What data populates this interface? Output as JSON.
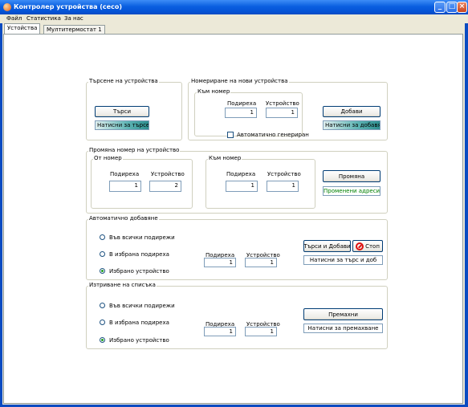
{
  "window": {
    "title": "Контролер устройства (сесо)"
  },
  "menu": [
    "Файл",
    "Статистика",
    "За нас"
  ],
  "tabs": [
    "Устойства",
    "Мултитермостат 1"
  ],
  "search": {
    "legend": "Търсене на устройства",
    "button": "Търси",
    "status": "Натисни за търсене"
  },
  "numbering": {
    "legend": "Номериране на нови устройства",
    "sub_legend": "Към номер",
    "section_label": "Подиреха",
    "device_label": "Устройство",
    "section_value": "1",
    "device_value": "1",
    "auto_label": "Автоматично генериран",
    "add_button": "Добави",
    "status": "Натисни за добавяне"
  },
  "change": {
    "legend": "Промяна номер на устройство",
    "from_legend": "От номер",
    "to_legend": "Към номер",
    "section_label": "Подиреха",
    "device_label": "Устройство",
    "from_section": "1",
    "from_device": "2",
    "to_section": "1",
    "to_device": "1",
    "button": "Промяна",
    "status": "Променени адреси!"
  },
  "auto_add": {
    "legend": "Автоматично добавяне",
    "radios": [
      "Във всички подирежи",
      "В избрана подиреха",
      "Избрано устройство"
    ],
    "selected": 2,
    "section_label": "Подиреха",
    "device_label": "Устройство",
    "section_value": "1",
    "device_value": "1",
    "search_add_button": "Търси и Добави",
    "stop_button": "Стоп",
    "status": "Натисни за търс и доб"
  },
  "remove": {
    "legend": "Изтриване на списъка",
    "radios": [
      "Във всички подирежи",
      "В избрана подиреха",
      "Избрано устройство"
    ],
    "selected": 2,
    "section_label": "Подиреха",
    "device_label": "Устройство",
    "section_value": "1",
    "device_value": "1",
    "button": "Премахни",
    "status": "Натисни за премахване"
  }
}
